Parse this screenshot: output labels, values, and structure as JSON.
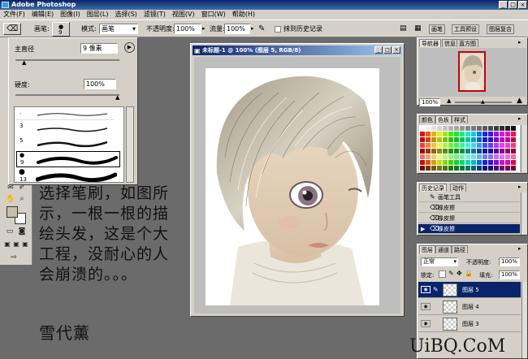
{
  "app": {
    "title": "Adobe Photoshop",
    "min": "_",
    "max": "□",
    "close": "×"
  },
  "menu": [
    "文件(F)",
    "编辑(E)",
    "图像(I)",
    "图层(L)",
    "选择(S)",
    "滤镜(T)",
    "视图(V)",
    "窗口(W)",
    "帮助(H)"
  ],
  "options": {
    "brush_label": "画笔:",
    "brush_size": "9",
    "mode_label": "模式:",
    "mode_value": "画笔",
    "opacity_label": "不透明度:",
    "opacity_value": "100%",
    "flow_label": "流量:",
    "flow_value": "100%",
    "erase_history_label": "抹到历史记录",
    "well_tabs": [
      "画笔",
      "工具预设",
      "图层复合"
    ]
  },
  "brush_panel": {
    "master_diameter_label": "主直径",
    "master_diameter_value": "9 像素",
    "hardness_label": "硬度:",
    "hardness_value": "100%",
    "presets": [
      "3",
      "5",
      "9",
      "13"
    ]
  },
  "document": {
    "title": "未标题-1 @ 100% (图层 5, RGB/8)"
  },
  "navigator": {
    "tabs": [
      "导航器",
      "信息",
      "直方图"
    ],
    "zoom": "100%"
  },
  "color_panel": {
    "tabs": [
      "颜色",
      "色板",
      "样式"
    ]
  },
  "history": {
    "tabs": [
      "历史记录",
      "动作"
    ],
    "items": [
      "画笔工具",
      "橡皮擦",
      "橡皮擦",
      "橡皮擦"
    ]
  },
  "layers": {
    "tabs": [
      "图层",
      "通道",
      "路径"
    ],
    "blend_mode": "正常",
    "opacity_label": "不透明度:",
    "opacity_value": "100%",
    "lock_label": "锁定:",
    "fill_label": "填充:",
    "fill_value": "100%",
    "items": [
      "图层 5",
      "图层 4",
      "图层 3"
    ]
  },
  "annotation": {
    "lines": [
      "选择笔刷，如图所",
      "示，一根一根的描",
      "绘头发，这是个大",
      "工程，没耐心的人",
      "会崩溃的。。。"
    ],
    "author": "雪代薰"
  },
  "watermark": "UiBQ.CoM",
  "colors": {
    "foreground": "#c8c0a8",
    "background": "#ffffff",
    "title_blue": "#0a246a",
    "workspace": "#6b6b6b"
  }
}
